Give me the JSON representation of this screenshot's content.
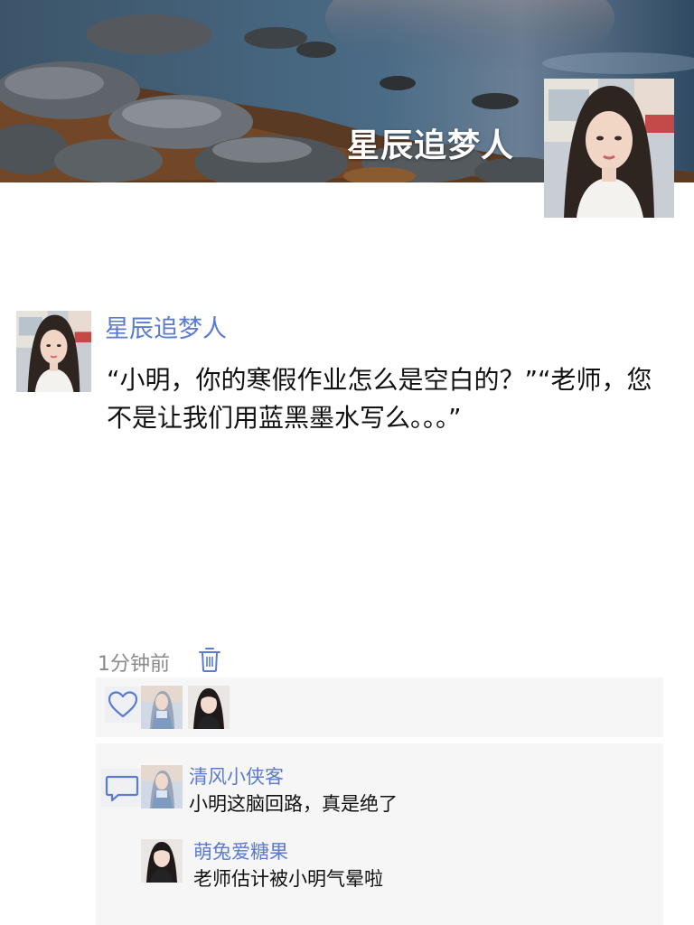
{
  "cover": {
    "title": "星辰追梦人"
  },
  "post": {
    "author": "星辰追梦人",
    "text": "“小明，你的寒假作业怎么是空白的？”“老师，您不是让我们用蓝黑墨水写么。。。”",
    "time": "1分钟前"
  },
  "icons": {
    "delete": "trash-icon",
    "like": "heart-icon",
    "comment": "comment-bubble-icon"
  },
  "colors": {
    "accent": "#5b7bd0",
    "panel_bg": "#f6f6f6",
    "meta_text": "#8a8a8a"
  },
  "comments": [
    {
      "author": "清风小侠客",
      "text": "小明这脑回路，真是绝了"
    },
    {
      "author": "萌兔爱糖果",
      "text": "老师估计被小明气晕啦"
    }
  ]
}
